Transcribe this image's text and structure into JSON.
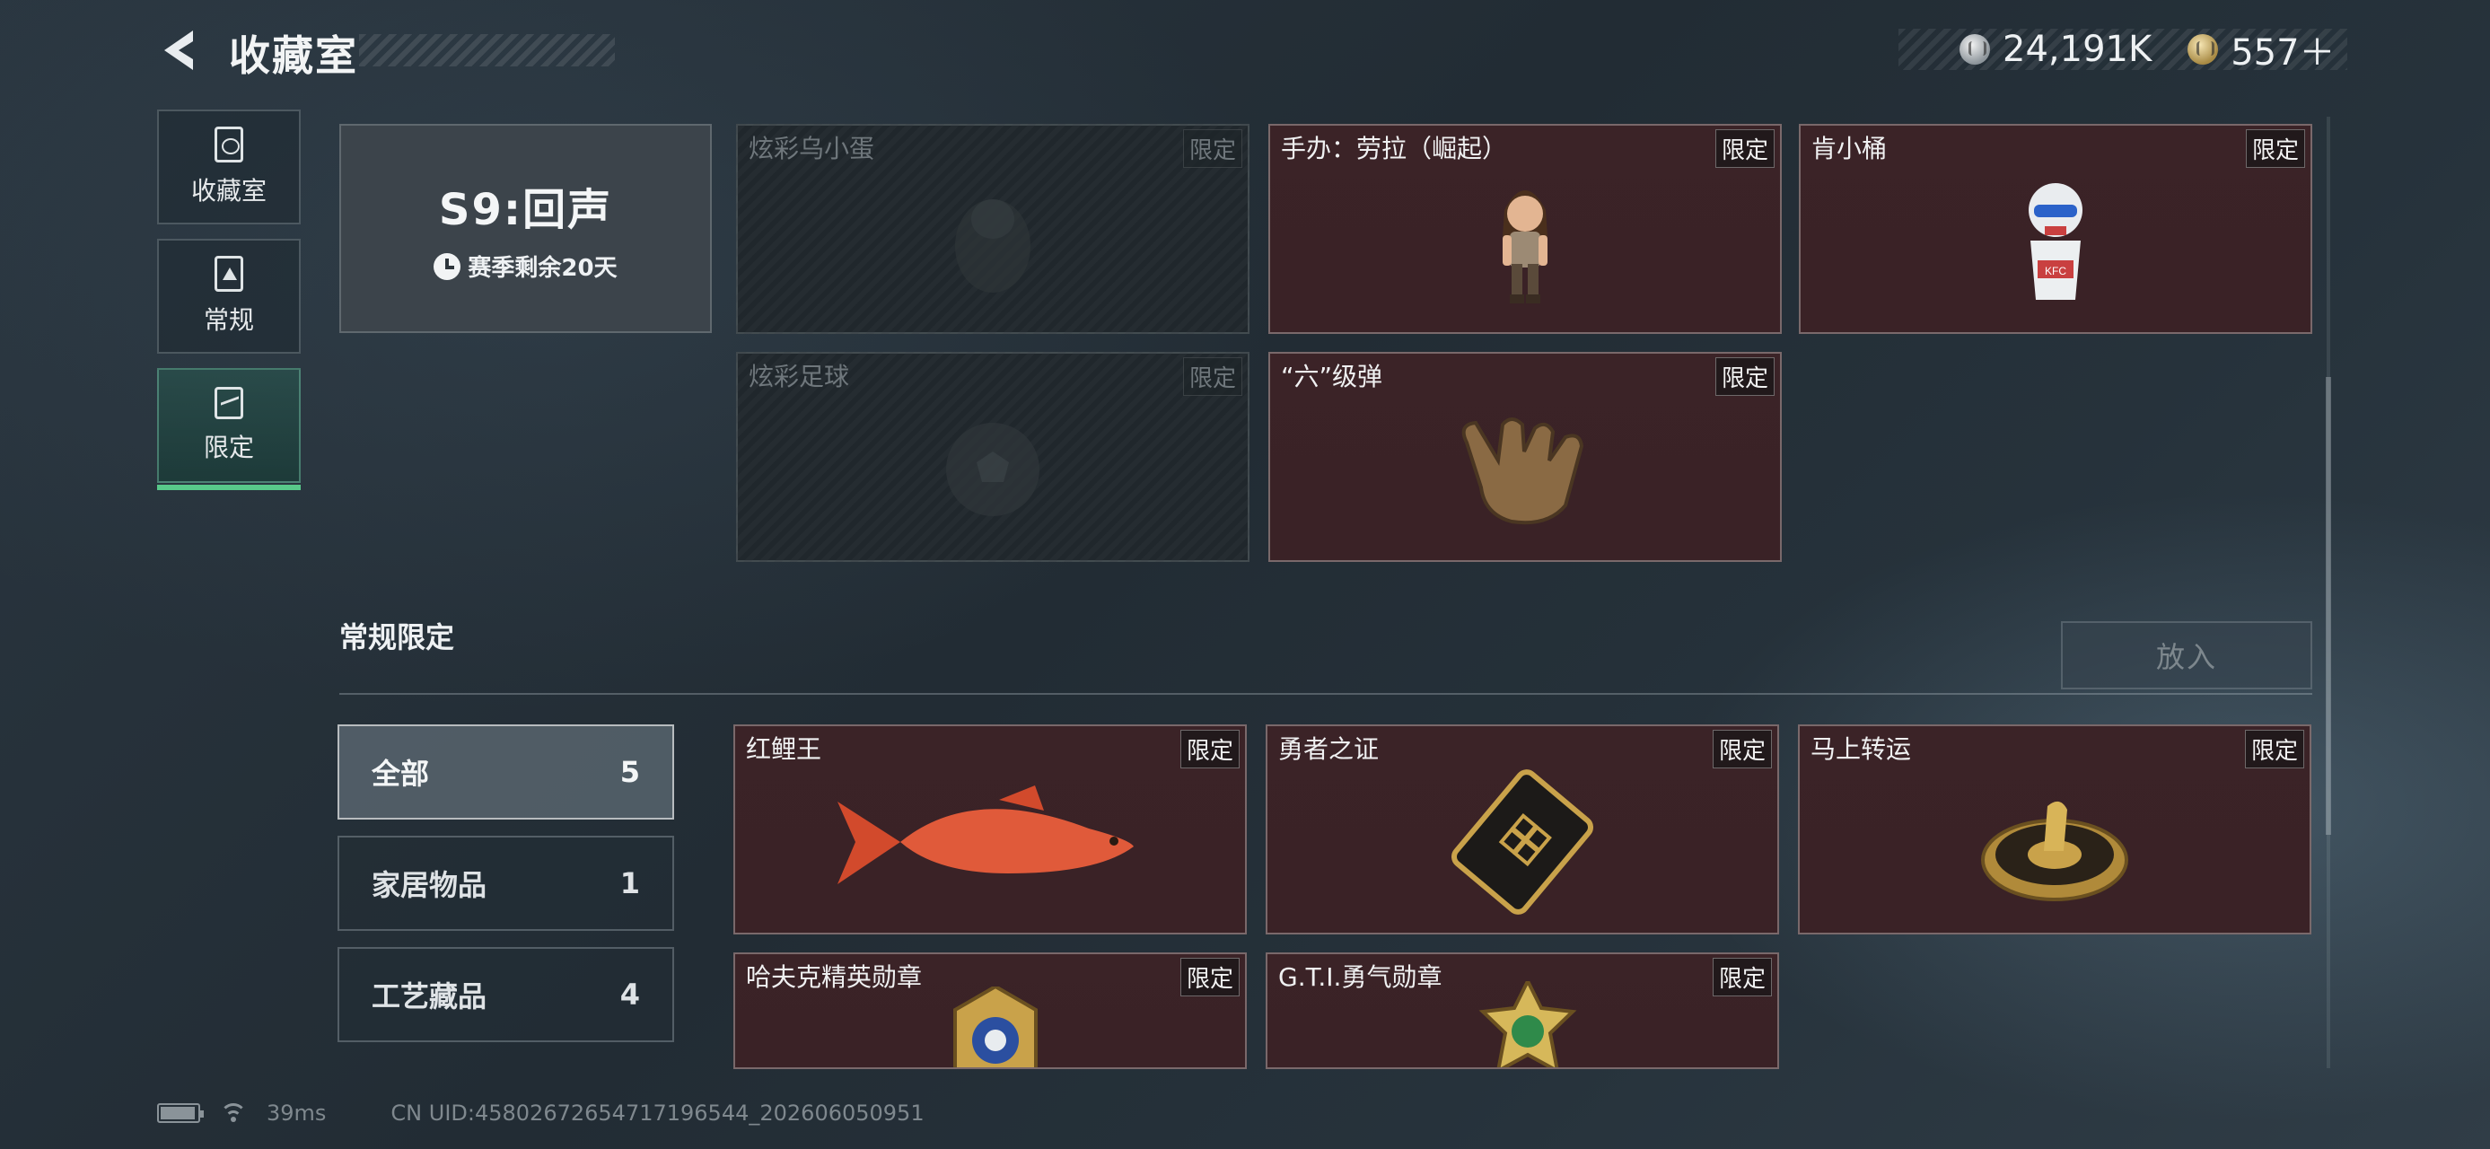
{
  "header": {
    "title": "收藏室",
    "currency": [
      {
        "icon": "silver-coin-icon",
        "value": "24,191K"
      },
      {
        "icon": "gold-coin-icon",
        "value": "557＋"
      }
    ]
  },
  "sidebar": {
    "items": [
      {
        "label": "收藏室",
        "icon": "collection-room-icon",
        "active": false
      },
      {
        "label": "常规",
        "icon": "regular-icon",
        "active": false
      },
      {
        "label": "限定",
        "icon": "limited-icon",
        "active": true
      }
    ]
  },
  "season": {
    "title": "S9:回声",
    "remaining": "赛季剩余20天"
  },
  "season_items": [
    {
      "title": "炫彩乌小蛋",
      "badge": "限定",
      "locked": true,
      "icon": "egg-figure-icon"
    },
    {
      "title": "手办：劳拉（崛起）",
      "badge": "限定",
      "locked": false,
      "icon": "lara-figure-icon"
    },
    {
      "title": "肯小桶",
      "badge": "限定",
      "locked": false,
      "icon": "kfc-bucket-figure-icon"
    },
    {
      "title": "炫彩足球",
      "badge": "限定",
      "locked": true,
      "icon": "football-icon"
    },
    {
      "title": "“六”级弹",
      "badge": "限定",
      "locked": false,
      "icon": "hand-gesture-icon"
    }
  ],
  "section": {
    "title": "常规限定",
    "put_in_label": "放入"
  },
  "filters": [
    {
      "label": "全部",
      "count": "5",
      "active": true
    },
    {
      "label": "家居物品",
      "count": "1",
      "active": false
    },
    {
      "label": "工艺藏品",
      "count": "4",
      "active": false
    }
  ],
  "regular_items": [
    {
      "title": "红鲤王",
      "badge": "限定",
      "icon": "red-carp-icon"
    },
    {
      "title": "勇者之证",
      "badge": "限定",
      "icon": "brave-card-icon"
    },
    {
      "title": "马上转运",
      "badge": "限定",
      "icon": "horse-wheel-icon"
    },
    {
      "title": "哈夫克精英勋章",
      "badge": "限定",
      "icon": "elite-medal-icon"
    },
    {
      "title": "G.T.I.勇气勋章",
      "badge": "限定",
      "icon": "courage-medal-icon"
    }
  ],
  "status": {
    "ping": "39ms",
    "uid": "CN UID:4580267265471719654​4_202606050951"
  }
}
